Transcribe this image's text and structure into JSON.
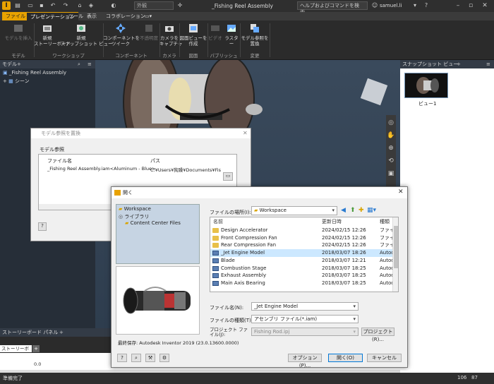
{
  "window": {
    "title": "_Fishing Reel Assembly",
    "help_search": "ヘルプおよびコマンドを検索...",
    "user": "samuel.li",
    "appearance": "外観"
  },
  "tabs": [
    "ファイル",
    "プレゼンテーション",
    "ツール",
    "表示",
    "コラボレーション"
  ],
  "ribbon": {
    "buttons": [
      {
        "label": "モデルを挿入",
        "enabled": false
      },
      {
        "label": "新規\nストーリーボード",
        "enabled": true
      },
      {
        "label": "新規\nスナップショット ビュー",
        "enabled": true
      },
      {
        "label": "コンポーネントを\nツイーク",
        "enabled": true
      },
      {
        "label": "不透明度",
        "enabled": false
      },
      {
        "label": "カメラを\nキャプチャ",
        "enabled": true
      },
      {
        "label": "図面ビューを\n作成",
        "enabled": true
      },
      {
        "label": "ビデオ",
        "enabled": false
      },
      {
        "label": "ラスター",
        "enabled": true
      },
      {
        "label": "モデル参照を\n置換",
        "enabled": true
      }
    ],
    "groups": [
      "モデル",
      "ワークショップ",
      "コンポーネント",
      "カメラ",
      "図面",
      "パブリッシュ",
      "変更"
    ]
  },
  "model_panel": {
    "title": "モデル",
    "items": [
      "_Fishing Reel Assembly",
      "シーン"
    ]
  },
  "snapshot_panel": {
    "title": "スナップショット ビュー",
    "thumb_label": "ビュー1"
  },
  "storyboard": {
    "panel_title": "ストーリーボード パネル",
    "tab": "ストーリーボード1",
    "time": "0.0"
  },
  "status": {
    "text": "準備完了",
    "num1": "106",
    "num2": "87"
  },
  "replace_dialog": {
    "title": "モデル参照を置換",
    "section": "モデル参照",
    "col_name": "ファイル名",
    "col_path": "パス",
    "row_name": "_Fishing Reel Assembly.iam<Aluminum - Blue>",
    "row_path": "C:¥Users¥狗躁¥Documents¥Fis"
  },
  "open_dialog": {
    "title": "開く",
    "places": [
      {
        "label": "Workspace",
        "icon": "folder-icon"
      },
      {
        "label": "ライブラリ",
        "icon": "library-icon"
      },
      {
        "label": "Content Center Files",
        "icon": "folder-icon"
      }
    ],
    "lookin_label": "ファイルの場所(I):",
    "lookin_value": "Workspace",
    "columns": {
      "name": "名前",
      "date": "更新日時",
      "type": "種類"
    },
    "files": [
      {
        "name": "Design Accelerator",
        "date": "2024/02/15 12:26",
        "type": "ファイ",
        "icon": "folder-icon",
        "selected": false
      },
      {
        "name": "Front Compression Fan",
        "date": "2024/02/15 12:26",
        "type": "ファイ",
        "icon": "folder-icon",
        "selected": false
      },
      {
        "name": "Rear Compression Fan",
        "date": "2024/02/15 12:26",
        "type": "ファイ",
        "icon": "folder-icon",
        "selected": false
      },
      {
        "name": "_Jet Engine Model",
        "date": "2018/03/07 18:26",
        "type": "Autod",
        "icon": "assembly-icon",
        "selected": true
      },
      {
        "name": "Blade",
        "date": "2018/03/07 12:21",
        "type": "Autod",
        "icon": "assembly-icon",
        "selected": false
      },
      {
        "name": "Combustion Stage",
        "date": "2018/03/07 18:25",
        "type": "Autod",
        "icon": "assembly-icon",
        "selected": false
      },
      {
        "name": "Exhaust Assembly",
        "date": "2018/03/07 18:25",
        "type": "Autod",
        "icon": "assembly-icon",
        "selected": false
      },
      {
        "name": "Main Axis Bearing",
        "date": "2018/03/07 18:25",
        "type": "Autod",
        "icon": "assembly-icon",
        "selected": false
      }
    ],
    "filename_label": "ファイル名(N):",
    "filename_value": "_Jet Engine Model",
    "filetype_label": "ファイルの種類(T):",
    "filetype_value": "アセンブリ ファイル(*.iam)",
    "project_label": "プロジェクト ファイル(J):",
    "project_value": "Fishing Rod.ipj",
    "project_button": "プロジェクト(R)...",
    "saved_with": "最終保存: Autodesk Inventor 2019 (23.0.13600.0000)",
    "options_button": "オプション(P)...",
    "open_button": "開く(O)",
    "cancel_button": "キャンセル"
  },
  "colors": {
    "accent": "#e8a200",
    "selection": "#cce8ff",
    "dialog_bg": "#f0f0f0"
  }
}
